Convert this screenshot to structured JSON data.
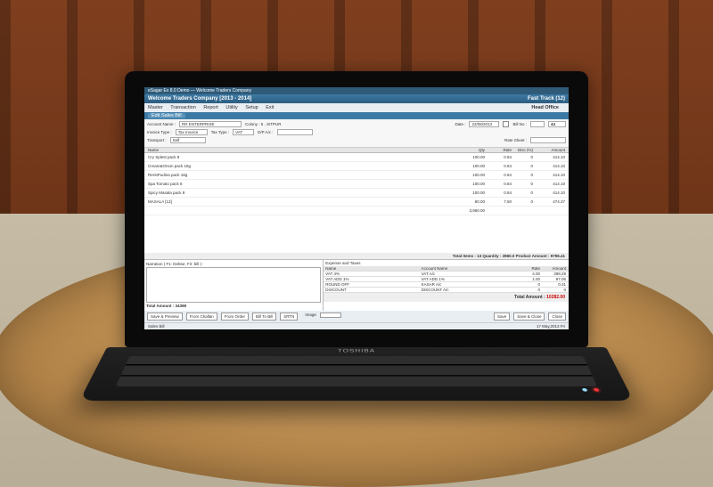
{
  "titlebar": {
    "app": "eSagar Ex 8.0 Demo — Welcome Traders Company"
  },
  "company": {
    "left": "Welcome Traders Company    [2013 - 2014]",
    "right_a": "Fast Track (12)",
    "right_b": "Head Office"
  },
  "menu": {
    "items": [
      "Master",
      "Transaction",
      "Report",
      "Utility",
      "Setup",
      "Exit"
    ]
  },
  "tab": {
    "active": "Edit Sales Bill"
  },
  "form": {
    "account_label": "Account Name :",
    "account_value": "RR ENTERPRISE",
    "colony_label": "Colony : 5 ,  SITPUR",
    "date_label": "Date :",
    "date_value": "22/08/2013",
    "billno_label": "Bill No :",
    "billno_value": "44",
    "invtype_label": "Invoice Type :",
    "invtype_value": "Tax Invoice",
    "taxtype_label": "Tax Type :",
    "taxtype_value": "VAT",
    "dispto_label": "D/P A/c :",
    "transport_label": "Transport :",
    "transport_value": "Self",
    "ratesheet_label": "Rate Sheet :"
  },
  "grid": {
    "columns": [
      "Name",
      "Qty",
      "Rate",
      "Disc (%)",
      "Amount"
    ],
    "rows": [
      {
        "name": "Cry Splest  pack 8",
        "qty": "100.00",
        "rate": "0.84",
        "disc": "0",
        "amt": "414.10"
      },
      {
        "name": "Cream&Onion  pack 18g",
        "qty": "100.00",
        "rate": "0.84",
        "disc": "0",
        "amt": "414.10"
      },
      {
        "name": "RerstPudina  pack 18g",
        "qty": "100.00",
        "rate": "0.84",
        "disc": "0",
        "amt": "414.10"
      },
      {
        "name": "Spa Tomato  pack 8",
        "qty": "100.00",
        "rate": "0.84",
        "disc": "0",
        "amt": "414.10"
      },
      {
        "name": "Spicy Masala  pack 8",
        "qty": "100.00",
        "rate": "0.84",
        "disc": "0",
        "amt": "414.10"
      },
      {
        "name": "MASALA [13]",
        "qty": "80.00",
        "rate": "7.50",
        "disc": "0",
        "amt": "474.37"
      }
    ],
    "sumline_qty": "3,960.00",
    "totals": "Total Items :  13    Quantity :  3960.0  Product Amount :    9796.41"
  },
  "narration": {
    "label": "Narration ( F1: Debtor, F2: bill ) :"
  },
  "tax": {
    "header": "Expense and Taxes",
    "columns": [
      "Name",
      "Account Name",
      "Rate",
      "Amount"
    ],
    "rows": [
      {
        "name": "VAT 4%",
        "acc": "VAT A/c",
        "rate": "4.00",
        "amt": "388.28"
      },
      {
        "name": "VAT ADD 1%",
        "acc": "VAT ADD 1%",
        "rate": "1.00",
        "amt": "97.06"
      },
      {
        "name": "ROUND OFF",
        "acc": "KASAR A/c",
        "rate": "0",
        "amt": "0.31"
      },
      {
        "name": "DISCOUNT",
        "acc": "DISCOUNT A/c",
        "rate": "0",
        "amt": "0"
      }
    ]
  },
  "totals": {
    "label": "Total Amount :",
    "value": "10282.00",
    "basic_label": "Total Amount :  34398"
  },
  "buttons": {
    "save_preview": "Save & Preview",
    "from_challan": "From Challan",
    "from_order": "From Order",
    "bill_to_bill": "Bill To Bill",
    "srtn": "SRTN",
    "image_label": "Image",
    "save": "Save",
    "save_close": "Save & Close",
    "close": "Close"
  },
  "status": {
    "left": "Sales Bill",
    "right": "17 May,2013  Fri"
  },
  "laptop_brand": "TOSHIBA"
}
